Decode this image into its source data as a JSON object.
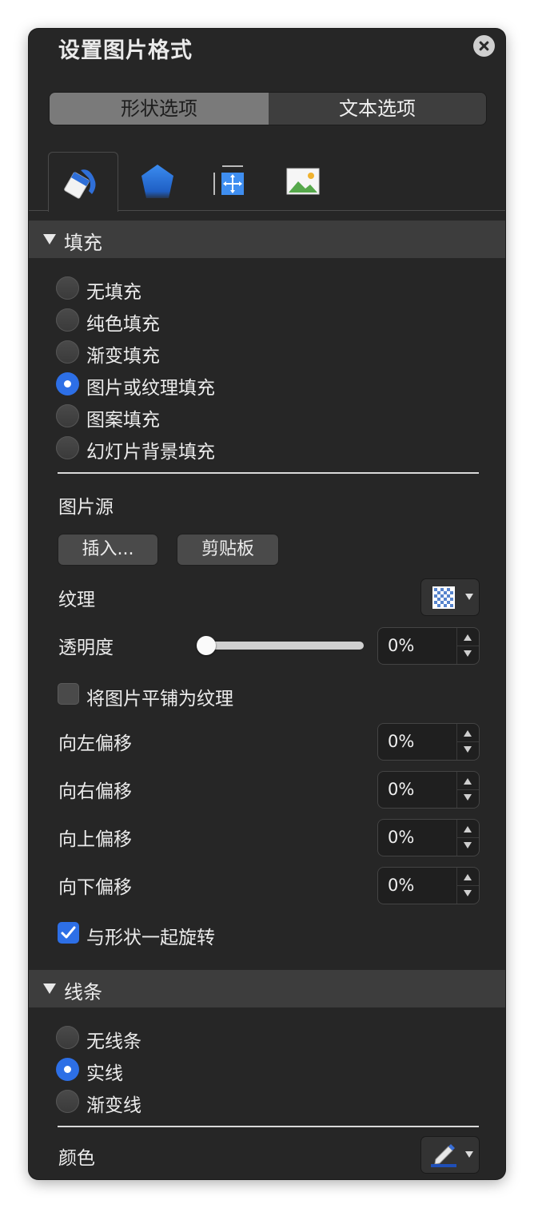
{
  "title": "设置图片格式",
  "segments": [
    "形状选项",
    "文本选项"
  ],
  "tabs": [
    "fill-bucket-icon",
    "pentagon-shape-icon",
    "size-position-icon",
    "picture-icon"
  ],
  "fill": {
    "header": "填充",
    "options": [
      "无填充",
      "纯色填充",
      "渐变填充",
      "图片或纹理填充",
      "图案填充",
      "幻灯片背景填充"
    ],
    "selected_index": 3,
    "picture_source_label": "图片源",
    "insert_button": "插入...",
    "clipboard_button": "剪贴板",
    "texture_label": "纹理",
    "transparency_label": "透明度",
    "transparency_value": "0%",
    "transparency_level": 0,
    "tile_checkbox": "将图片平铺为纹理",
    "tile_checked": false,
    "offsets": [
      {
        "label": "向左偏移",
        "value": "0%"
      },
      {
        "label": "向右偏移",
        "value": "0%"
      },
      {
        "label": "向上偏移",
        "value": "0%"
      },
      {
        "label": "向下偏移",
        "value": "0%"
      }
    ],
    "rotate_checkbox": "与形状一起旋转",
    "rotate_checked": true
  },
  "line": {
    "header": "线条",
    "options": [
      "无线条",
      "实线",
      "渐变线"
    ],
    "selected_index": 1,
    "color_label": "颜色"
  },
  "colors": {
    "accent": "#2d6fe6",
    "panel": "#262626",
    "section": "#3d3d3d"
  }
}
